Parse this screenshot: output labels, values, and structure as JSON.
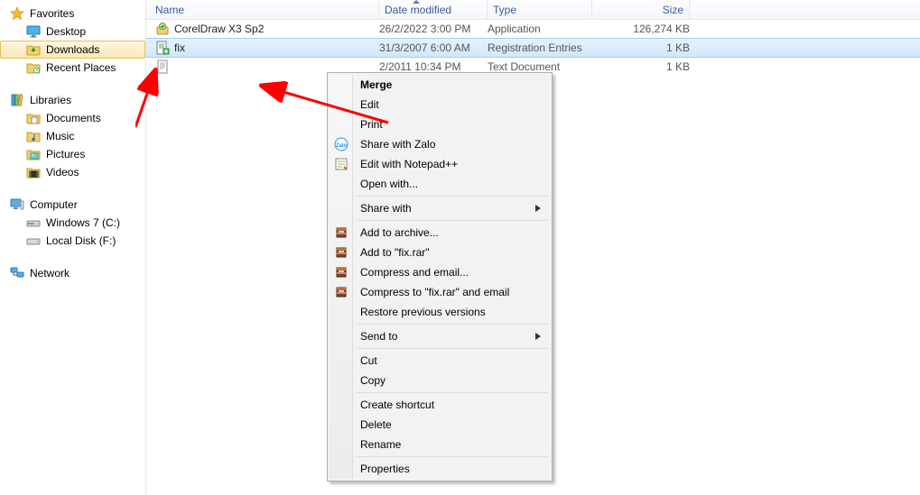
{
  "sidebar": {
    "favorites": {
      "label": "Favorites",
      "items": [
        {
          "label": "Desktop"
        },
        {
          "label": "Downloads",
          "selected": true
        },
        {
          "label": "Recent Places"
        }
      ]
    },
    "libraries": {
      "label": "Libraries",
      "items": [
        {
          "label": "Documents"
        },
        {
          "label": "Music"
        },
        {
          "label": "Pictures"
        },
        {
          "label": "Videos"
        }
      ]
    },
    "computer": {
      "label": "Computer",
      "items": [
        {
          "label": "Windows 7 (C:)"
        },
        {
          "label": "Local Disk (F:)"
        }
      ]
    },
    "network": {
      "label": "Network"
    }
  },
  "columns": {
    "name": "Name",
    "date": "Date modified",
    "type": "Type",
    "size": "Size"
  },
  "files": [
    {
      "name": "CorelDraw X3 Sp2",
      "date": "26/2/2022 3:00 PM",
      "type": "Application",
      "size": "126,274 KB",
      "icon": "installer"
    },
    {
      "name": "fix",
      "date": "31/3/2007 6:00 AM",
      "type": "Registration Entries",
      "size": "1 KB",
      "icon": "reg",
      "selected": true
    },
    {
      "name": "",
      "date": "2/2011 10:34 PM",
      "type": "Text Document",
      "size": "1 KB",
      "icon": "txt",
      "partial_date": true
    }
  ],
  "context_menu": [
    {
      "label": "Merge",
      "bold": true
    },
    {
      "label": "Edit"
    },
    {
      "label": "Print"
    },
    {
      "label": "Share with Zalo",
      "icon": "zalo"
    },
    {
      "label": "Edit with Notepad++",
      "icon": "npp"
    },
    {
      "label": "Open with..."
    },
    {
      "sep": true
    },
    {
      "label": "Share with",
      "submenu": true
    },
    {
      "sep": true
    },
    {
      "label": "Add to archive...",
      "icon": "rar"
    },
    {
      "label": "Add to \"fix.rar\"",
      "icon": "rar"
    },
    {
      "label": "Compress and email...",
      "icon": "rar"
    },
    {
      "label": "Compress to \"fix.rar\" and email",
      "icon": "rar"
    },
    {
      "label": "Restore previous versions"
    },
    {
      "sep": true
    },
    {
      "label": "Send to",
      "submenu": true
    },
    {
      "sep": true
    },
    {
      "label": "Cut"
    },
    {
      "label": "Copy"
    },
    {
      "sep": true
    },
    {
      "label": "Create shortcut"
    },
    {
      "label": "Delete"
    },
    {
      "label": "Rename"
    },
    {
      "sep": true
    },
    {
      "label": "Properties"
    }
  ]
}
